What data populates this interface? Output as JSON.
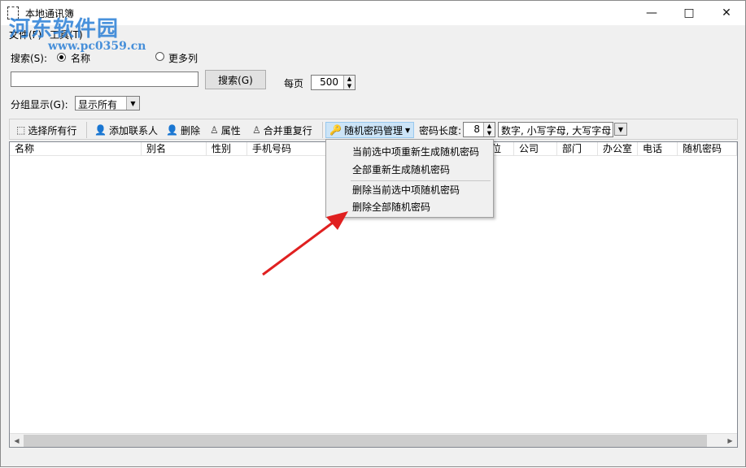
{
  "window": {
    "title": "本地通讯簿"
  },
  "watermark": {
    "line1": "河东软件园",
    "line2": "www.pc0359.cn"
  },
  "menu": [
    "文件(F)",
    "工具(T)"
  ],
  "search": {
    "label": "搜索(S):",
    "option_name": "名称",
    "option_more": "更多列",
    "value": "",
    "button": "搜索(G)",
    "per_page_label": "每页",
    "per_page_value": "500"
  },
  "group": {
    "label": "分组显示(G):",
    "value": "显示所有"
  },
  "toolbar": {
    "select_all": "选择所有行",
    "add_contact": "添加联系人",
    "delete": "删除",
    "properties": "属性",
    "merge_dup": "合并重复行",
    "pwd_manage": "随机密码管理",
    "pwd_length_label": "密码长度:",
    "pwd_length_value": "8",
    "charset_value": "数字, 小写字母, 大写字母"
  },
  "columns": [
    "名称",
    "别名",
    "性别",
    "手机号码",
    "位",
    "公司",
    "部门",
    "办公室",
    "电话",
    "随机密码"
  ],
  "dropdown_items": [
    "当前选中项重新生成随机密码",
    "全部重新生成随机密码",
    "删除当前选中项随机密码",
    "删除全部随机密码"
  ],
  "colors": {
    "arrow": "#e02020",
    "watermark": "#2a7fd6"
  }
}
